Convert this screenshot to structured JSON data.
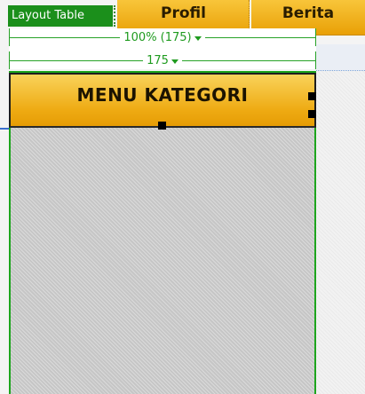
{
  "layout_table": {
    "tag_label": "Layout Table"
  },
  "nav": {
    "tabs": [
      {
        "label": "Profil"
      },
      {
        "label": "Berita"
      }
    ]
  },
  "rulers": {
    "table_width": "100% (175)",
    "column_width": "175"
  },
  "menu": {
    "title": "MENU KATEGORI"
  },
  "colors": {
    "tab_orange": "#f0a80e",
    "layout_green": "#1b8f1b",
    "cell_gray": "#c6c6c6"
  }
}
